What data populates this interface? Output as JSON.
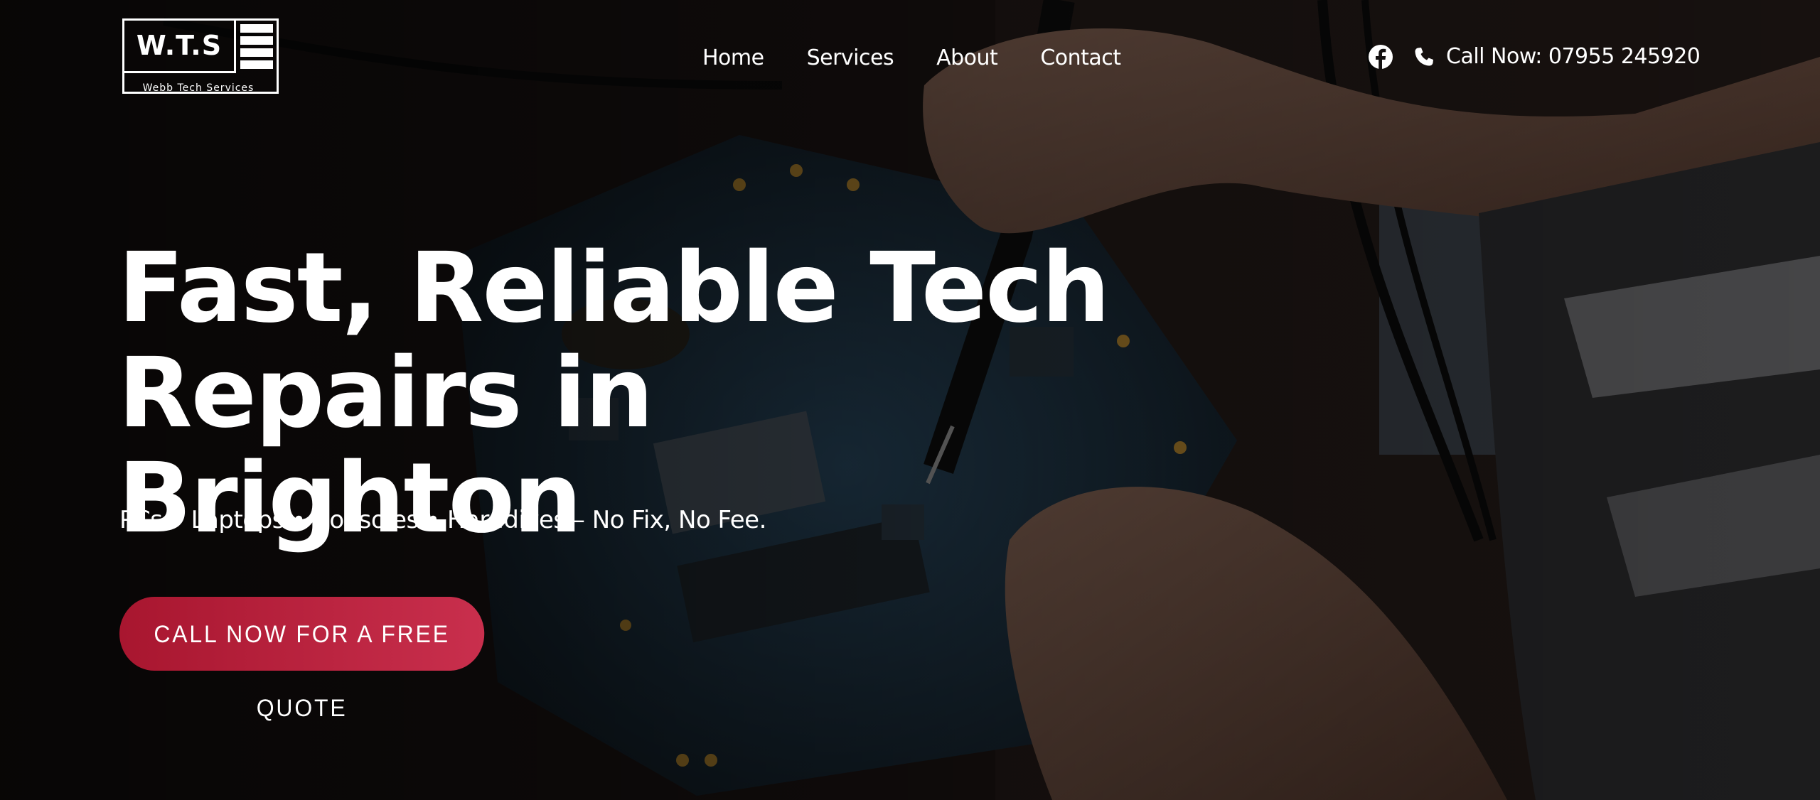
{
  "brand": {
    "logo_text": "W.T.S",
    "logo_subtext": "Webb Tech Services"
  },
  "nav": {
    "items": [
      {
        "label": "Home"
      },
      {
        "label": "Services"
      },
      {
        "label": "About"
      },
      {
        "label": "Contact"
      }
    ]
  },
  "header": {
    "social_icon": "facebook-icon",
    "phone_icon": "phone-icon",
    "call_label": "Call Now: 07955 245920"
  },
  "hero": {
    "headline_line1": "Fast, Reliable Tech",
    "headline_line2": "Repairs in Brighton",
    "tagline": "PCs • Laptops • Consoles • Harddives – No Fix, No Fee.",
    "cta_label": "CALL NOW FOR A FREE QUOTE"
  },
  "colors": {
    "cta_start": "#a8162f",
    "cta_end": "#c92f4d",
    "text": "#ffffff",
    "background": "#141111"
  }
}
